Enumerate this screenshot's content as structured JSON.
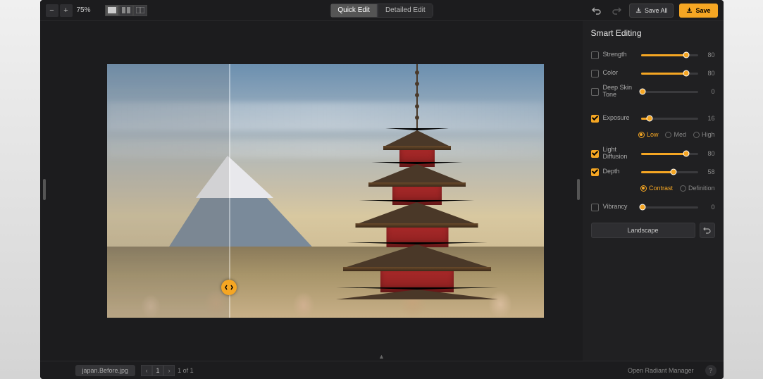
{
  "topbar": {
    "zoom_out": "−",
    "zoom_in": "+",
    "zoom_pct": "75%",
    "tab_quick": "Quick Edit",
    "tab_detailed": "Detailed Edit",
    "save_all": "Save All",
    "save": "Save"
  },
  "panel": {
    "title": "Smart Editing",
    "strength": {
      "label": "Strength",
      "value": 80,
      "checked": false
    },
    "color": {
      "label": "Color",
      "value": 80,
      "checked": false
    },
    "deepskin": {
      "label": "Deep Skin Tone",
      "value": 0,
      "checked": false
    },
    "exposure": {
      "label": "Exposure",
      "value": 16,
      "checked": true
    },
    "exposure_opts": {
      "low": "Low",
      "med": "Med",
      "high": "High",
      "selected": "low"
    },
    "lightdiff": {
      "label": "Light Diffusion",
      "value": 80,
      "checked": true
    },
    "depth": {
      "label": "Depth",
      "value": 58,
      "checked": true
    },
    "depth_opts": {
      "contrast": "Contrast",
      "definition": "Definition",
      "selected": "contrast"
    },
    "vibrancy": {
      "label": "Vibrancy",
      "value": 0,
      "checked": false
    },
    "preset": "Landscape"
  },
  "bottom": {
    "filename": "japan.Before.jpg",
    "page_cur": "1",
    "page_of": "1 of 1",
    "manager": "Open Radiant Manager"
  }
}
